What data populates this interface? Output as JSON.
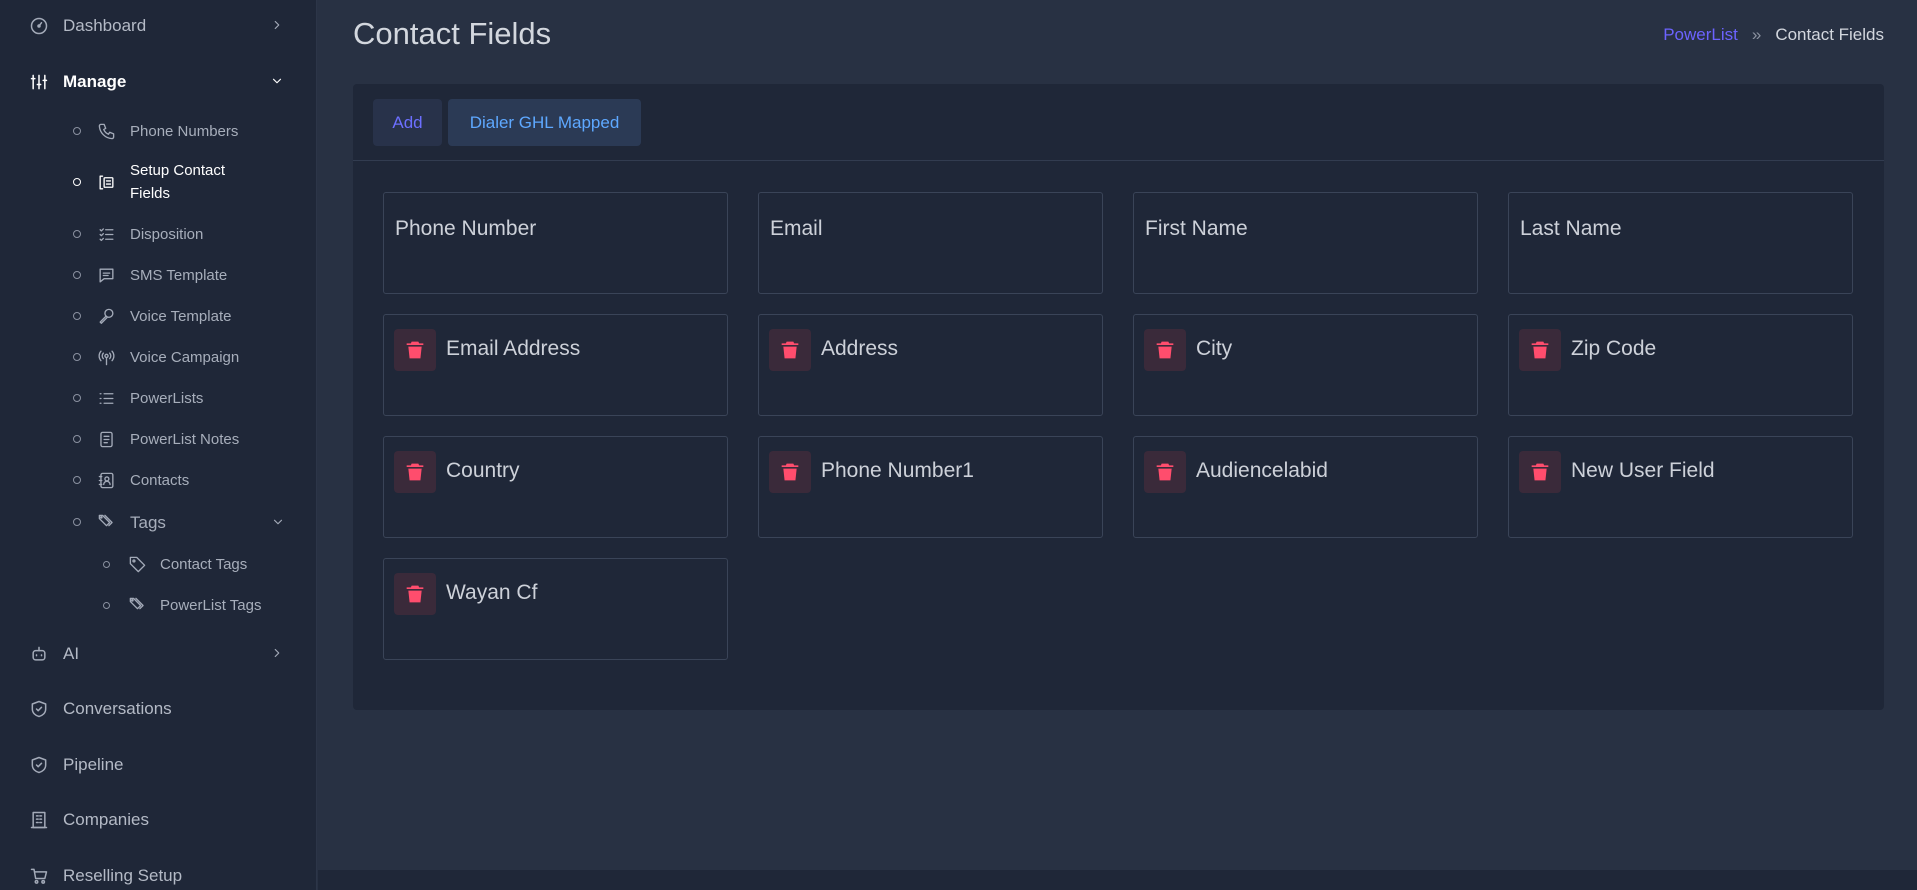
{
  "sidebar": {
    "dashboard": {
      "label": "Dashboard",
      "icon": "gauge-icon"
    },
    "manage": {
      "label": "Manage",
      "icon": "sliders-icon"
    },
    "manage_items": [
      {
        "label": "Phone Numbers",
        "icon": "phone-icon"
      },
      {
        "label": "Setup Contact Fields",
        "icon": "contact-form-icon"
      },
      {
        "label": "Disposition",
        "icon": "checklist-icon"
      },
      {
        "label": "SMS Template",
        "icon": "message-square-icon"
      },
      {
        "label": "Voice Template",
        "icon": "microphone-icon"
      },
      {
        "label": "Voice Campaign",
        "icon": "broadcast-icon"
      },
      {
        "label": "PowerLists",
        "icon": "list-icon"
      },
      {
        "label": "PowerList Notes",
        "icon": "notes-icon"
      },
      {
        "label": "Contacts",
        "icon": "address-book-icon"
      },
      {
        "label": "Tags",
        "icon": "tags-icon"
      }
    ],
    "tags_items": [
      {
        "label": "Contact Tags",
        "icon": "tag-icon"
      },
      {
        "label": "PowerList Tags",
        "icon": "tags-icon"
      }
    ],
    "ai": {
      "label": "AI",
      "icon": "robot-icon"
    },
    "conversations": {
      "label": "Conversations",
      "icon": "shield-check-icon"
    },
    "pipeline": {
      "label": "Pipeline",
      "icon": "shield-check-icon"
    },
    "companies": {
      "label": "Companies",
      "icon": "building-icon"
    },
    "reselling": {
      "label": "Reselling Setup",
      "icon": "cart-icon"
    }
  },
  "header": {
    "title": "Contact Fields",
    "breadcrumb": {
      "link": "PowerList",
      "separator": "»",
      "current": "Contact Fields"
    }
  },
  "toolbar": {
    "add_label": "Add",
    "dialer_label": "Dialer GHL Mapped"
  },
  "fields": {
    "fixed": [
      "Phone Number",
      "Email",
      "First Name",
      "Last Name"
    ],
    "custom": [
      "Email Address",
      "Address",
      "City",
      "Zip Code",
      "Country",
      "Phone Number1",
      "Audiencelabid",
      "New User Field",
      "Wayan Cf"
    ]
  },
  "colors": {
    "sidebar_bg": "#1f2738",
    "page_bg": "#283143",
    "accent": "#6c63ff",
    "link_blue": "#5ea8ff",
    "delete_red": "#ff4d6d"
  }
}
